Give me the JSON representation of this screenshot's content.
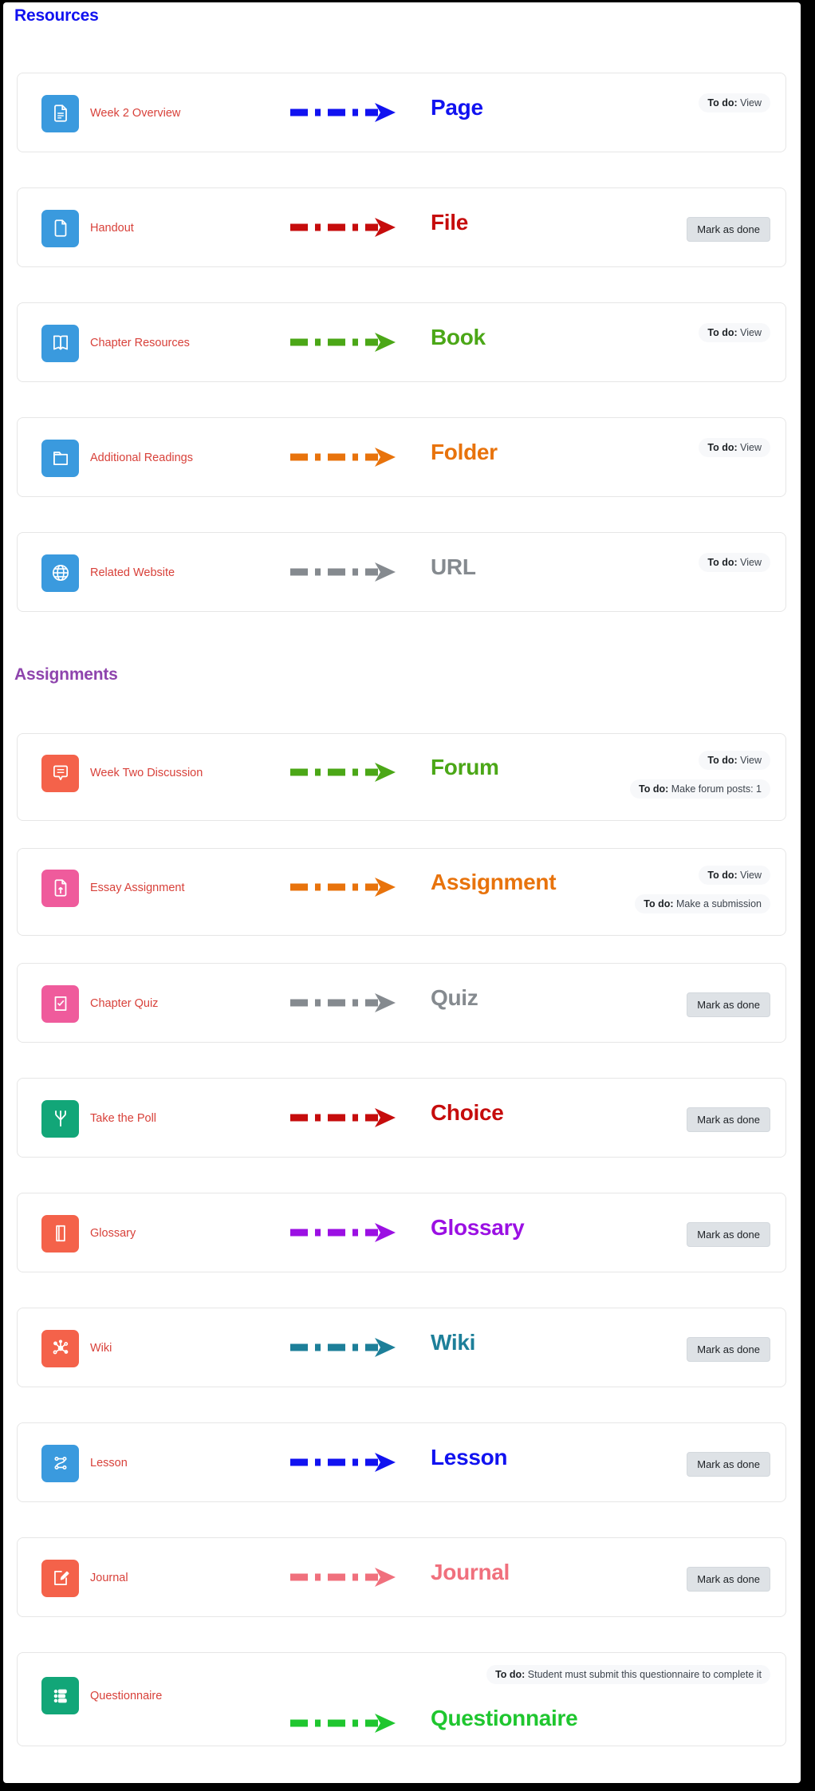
{
  "sections": [
    {
      "title": "Resources",
      "color": "#1112f0",
      "rows": [
        {
          "name": "Week 2 Overview",
          "type": "Page",
          "icon": "page-icon",
          "icon_bg": "#3a9ade",
          "accent": "#1112f0",
          "badges": [
            {
              "prefix": "To do:",
              "text": " View"
            }
          ],
          "button": null
        },
        {
          "name": "Handout",
          "type": "File",
          "icon": "file-icon",
          "icon_bg": "#3a9ade",
          "accent": "#c60c0c",
          "badges": [],
          "button": "Mark as done"
        },
        {
          "name": "Chapter Resources",
          "type": "Book",
          "icon": "book-icon",
          "icon_bg": "#3a9ade",
          "accent": "#4ba717",
          "badges": [
            {
              "prefix": "To do:",
              "text": " View"
            }
          ],
          "button": null
        },
        {
          "name": "Additional Readings",
          "type": "Folder",
          "icon": "folder-icon",
          "icon_bg": "#3a9ade",
          "accent": "#e8730c",
          "badges": [
            {
              "prefix": "To do:",
              "text": " View"
            }
          ],
          "button": null
        },
        {
          "name": "Related Website",
          "type": "URL",
          "icon": "globe-icon",
          "icon_bg": "#3a9ade",
          "accent": "#858a8f",
          "badges": [
            {
              "prefix": "To do:",
              "text": " View"
            }
          ],
          "button": null
        }
      ]
    },
    {
      "title": "Assignments",
      "color": "#8e44ad",
      "rows": [
        {
          "name": "Week Two Discussion",
          "type": "Forum",
          "icon": "forum-icon",
          "icon_bg": "#f4624a",
          "accent": "#4ba717",
          "badges": [
            {
              "prefix": "To do:",
              "text": " View"
            },
            {
              "prefix": "To do:",
              "text": " Make forum posts: 1"
            }
          ],
          "button": null
        },
        {
          "name": "Essay Assignment",
          "type": "Assignment",
          "icon": "assignment-icon",
          "icon_bg": "#ef5b9c",
          "accent": "#e8730c",
          "badges": [
            {
              "prefix": "To do:",
              "text": " View"
            },
            {
              "prefix": "To do:",
              "text": " Make a submission"
            }
          ],
          "button": null
        },
        {
          "name": "Chapter Quiz",
          "type": "Quiz",
          "icon": "quiz-icon",
          "icon_bg": "#ef5b9c",
          "accent": "#858a8f",
          "badges": [],
          "button": "Mark as done"
        },
        {
          "name": "Take the Poll",
          "type": "Choice",
          "icon": "choice-icon",
          "icon_bg": "#12a678",
          "accent": "#c60c0c",
          "badges": [],
          "button": "Mark as done"
        },
        {
          "name": "Glossary",
          "type": "Glossary",
          "icon": "glossary-icon",
          "icon_bg": "#f4624a",
          "accent": "#9b10e3",
          "badges": [],
          "button": "Mark as done"
        },
        {
          "name": "Wiki",
          "type": "Wiki",
          "icon": "wiki-icon",
          "icon_bg": "#f4624a",
          "accent": "#1d7f99",
          "badges": [],
          "button": "Mark as done"
        },
        {
          "name": "Lesson",
          "type": "Lesson",
          "icon": "lesson-icon",
          "icon_bg": "#3a9ade",
          "accent": "#1112f0",
          "badges": [],
          "button": "Mark as done"
        },
        {
          "name": "Journal",
          "type": "Journal",
          "icon": "journal-icon",
          "icon_bg": "#f4624a",
          "accent": "#f0707d",
          "badges": [],
          "button": "Mark as done"
        },
        {
          "name": "Questionnaire",
          "type": "Questionnaire",
          "icon": "questionnaire-icon",
          "icon_bg": "#12a678",
          "accent": "#1fc62f",
          "badges": [
            {
              "prefix": "To do:",
              "text": " Student must submit this questionnaire to complete it"
            }
          ],
          "button": null
        }
      ]
    }
  ]
}
